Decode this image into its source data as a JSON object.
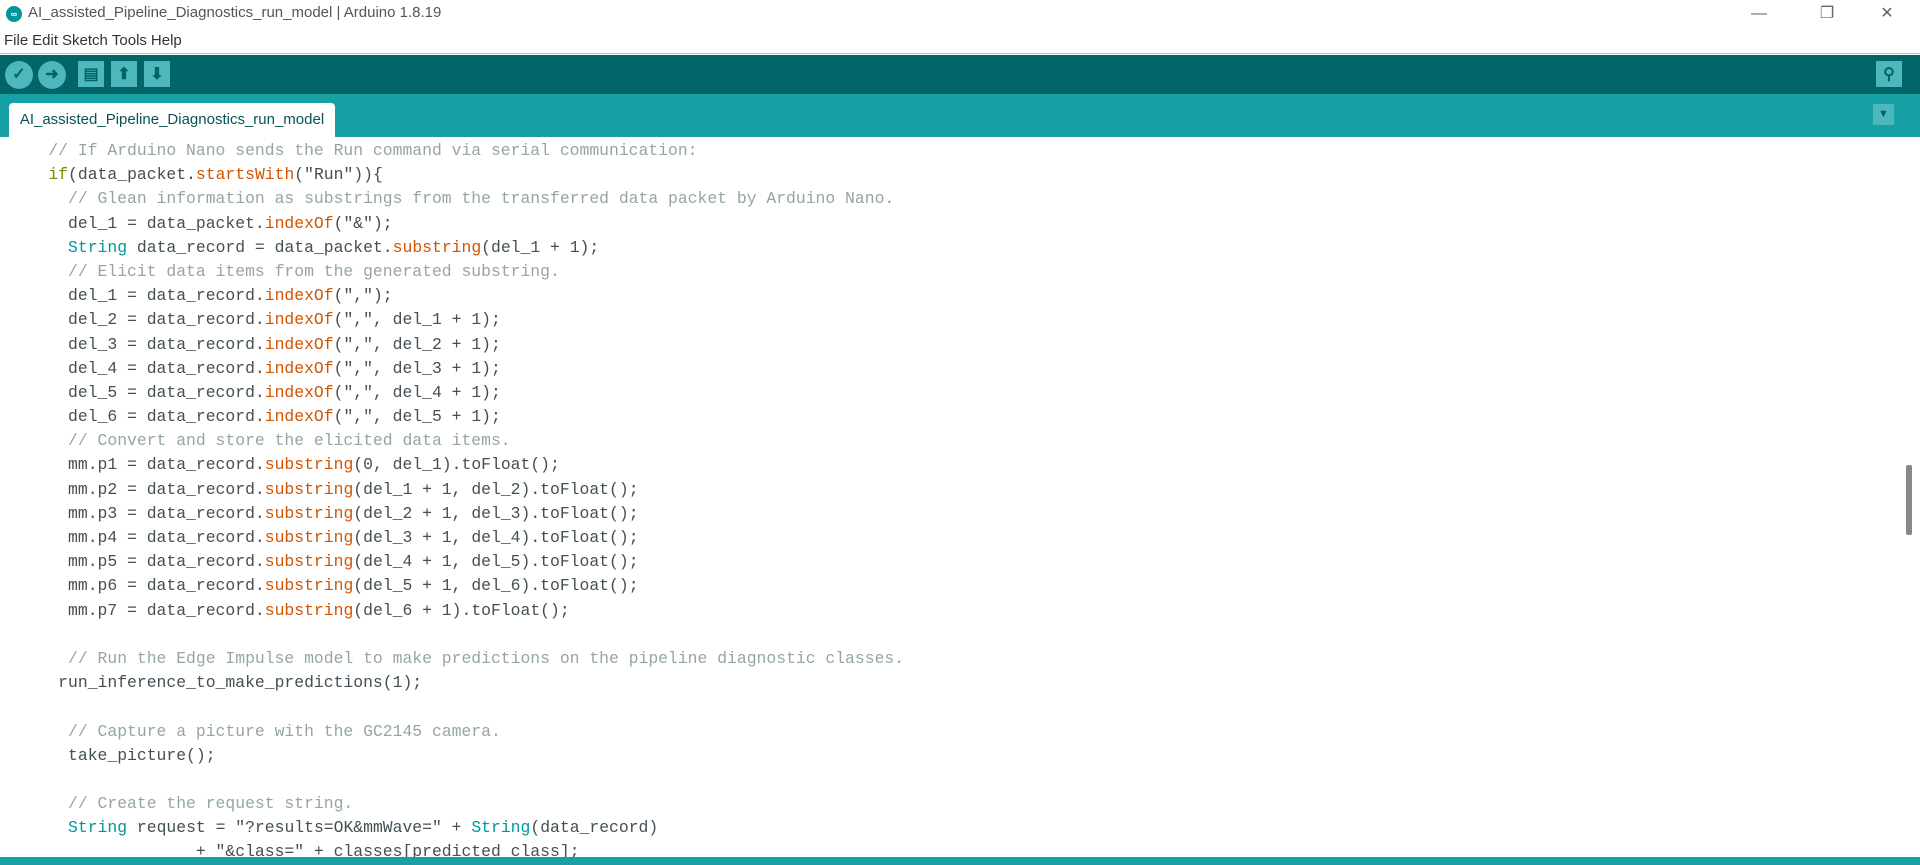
{
  "window": {
    "title": "AI_assisted_Pipeline_Diagnostics_run_model | Arduino 1.8.19",
    "app_icon": "∞",
    "minimize": "—",
    "restore": "❐",
    "close": "✕"
  },
  "menu": [
    "File",
    "Edit",
    "Sketch",
    "Tools",
    "Help"
  ],
  "toolbar": {
    "verify": "✓",
    "upload": "➜",
    "new": "▤",
    "open": "⬆",
    "save": "⬇",
    "serial_monitor": "⚲"
  },
  "tab": {
    "label": "AI_assisted_Pipeline_Diagnostics_run_model",
    "menu": "▼"
  },
  "colors": {
    "toolbar": "#006468",
    "tabbar": "#17a1a5",
    "comment": "#95a5a6",
    "method": "#d35400",
    "type": "#00979c",
    "keyword": "#728e00"
  },
  "code": [
    [
      [
        "    // If Arduino Nano sends the Run command via serial communication:",
        "c"
      ]
    ],
    [
      [
        "    ",
        ""
      ],
      [
        "if",
        "k"
      ],
      [
        "(data_packet.",
        ""
      ],
      [
        "startsWith",
        "m"
      ],
      [
        "(\"Run\")){",
        ""
      ]
    ],
    [
      [
        "      // Glean information as substrings from the transferred data packet by Arduino Nano.",
        "c"
      ]
    ],
    [
      [
        "      del_1 = data_packet.",
        ""
      ],
      [
        "indexOf",
        "m"
      ],
      [
        "(\"&\");",
        ""
      ]
    ],
    [
      [
        "      ",
        ""
      ],
      [
        "String",
        "t"
      ],
      [
        " data_record = data_packet.",
        ""
      ],
      [
        "substring",
        "m"
      ],
      [
        "(del_1 + 1);",
        ""
      ]
    ],
    [
      [
        "      // Elicit data items from the generated substring.",
        "c"
      ]
    ],
    [
      [
        "      del_1 = data_record.",
        ""
      ],
      [
        "indexOf",
        "m"
      ],
      [
        "(\",\");",
        ""
      ]
    ],
    [
      [
        "      del_2 = data_record.",
        ""
      ],
      [
        "indexOf",
        "m"
      ],
      [
        "(\",\", del_1 + 1);",
        ""
      ]
    ],
    [
      [
        "      del_3 = data_record.",
        ""
      ],
      [
        "indexOf",
        "m"
      ],
      [
        "(\",\", del_2 + 1);",
        ""
      ]
    ],
    [
      [
        "      del_4 = data_record.",
        ""
      ],
      [
        "indexOf",
        "m"
      ],
      [
        "(\",\", del_3 + 1);",
        ""
      ]
    ],
    [
      [
        "      del_5 = data_record.",
        ""
      ],
      [
        "indexOf",
        "m"
      ],
      [
        "(\",\", del_4 + 1);",
        ""
      ]
    ],
    [
      [
        "      del_6 = data_record.",
        ""
      ],
      [
        "indexOf",
        "m"
      ],
      [
        "(\",\", del_5 + 1);",
        ""
      ]
    ],
    [
      [
        "      // Convert and store the elicited data items.",
        "c"
      ]
    ],
    [
      [
        "      mm.p1 = data_record.",
        ""
      ],
      [
        "substring",
        "m"
      ],
      [
        "(0, del_1).toFloat();",
        ""
      ]
    ],
    [
      [
        "      mm.p2 = data_record.",
        ""
      ],
      [
        "substring",
        "m"
      ],
      [
        "(del_1 + 1, del_2).toFloat();",
        ""
      ]
    ],
    [
      [
        "      mm.p3 = data_record.",
        ""
      ],
      [
        "substring",
        "m"
      ],
      [
        "(del_2 + 1, del_3).toFloat();",
        ""
      ]
    ],
    [
      [
        "      mm.p4 = data_record.",
        ""
      ],
      [
        "substring",
        "m"
      ],
      [
        "(del_3 + 1, del_4).toFloat();",
        ""
      ]
    ],
    [
      [
        "      mm.p5 = data_record.",
        ""
      ],
      [
        "substring",
        "m"
      ],
      [
        "(del_4 + 1, del_5).toFloat();",
        ""
      ]
    ],
    [
      [
        "      mm.p6 = data_record.",
        ""
      ],
      [
        "substring",
        "m"
      ],
      [
        "(del_5 + 1, del_6).toFloat();",
        ""
      ]
    ],
    [
      [
        "      mm.p7 = data_record.",
        ""
      ],
      [
        "substring",
        "m"
      ],
      [
        "(del_6 + 1).toFloat();",
        ""
      ]
    ],
    [],
    [
      [
        "      // Run the Edge Impulse model to make predictions on the pipeline diagnostic classes.",
        "c"
      ]
    ],
    [
      [
        "     run_inference_to_make_predictions(1);",
        ""
      ]
    ],
    [],
    [
      [
        "      // Capture a picture with the GC2145 camera.",
        "c"
      ]
    ],
    [
      [
        "      take_picture();",
        ""
      ]
    ],
    [],
    [
      [
        "      // Create the request string.",
        "c"
      ]
    ],
    [
      [
        "      ",
        ""
      ],
      [
        "String",
        "t"
      ],
      [
        " request = \"?results=OK&mmWave=\" + ",
        ""
      ],
      [
        "String",
        "t"
      ],
      [
        "(data_record)",
        ""
      ]
    ],
    [
      [
        "                   + \"&class=\" + classes[predicted_class];",
        ""
      ]
    ]
  ]
}
